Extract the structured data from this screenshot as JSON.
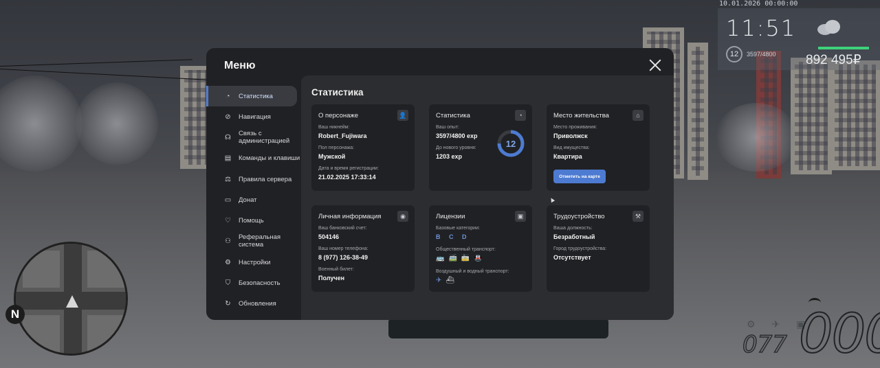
{
  "hud": {
    "datetime": "10.01.2026 00:00:00",
    "time": "11:51",
    "level": "12",
    "exp": "3597/4800",
    "money": "892 495₽",
    "speed": "000",
    "fuel": "077",
    "compass": "N"
  },
  "menu": {
    "title": "Меню",
    "sidebar": [
      {
        "label": "Статистика",
        "icon": "chart-icon",
        "glyph": "◔",
        "active": true
      },
      {
        "label": "Навигация",
        "icon": "compass-icon",
        "glyph": "⊘"
      },
      {
        "label": "Связь с администрацией",
        "icon": "headset-icon",
        "glyph": "☊"
      },
      {
        "label": "Команды и клавиши",
        "icon": "keyboard-icon",
        "glyph": "▤"
      },
      {
        "label": "Правила сервера",
        "icon": "scales-icon",
        "glyph": "⚖"
      },
      {
        "label": "Донат",
        "icon": "wallet-icon",
        "glyph": "▭"
      },
      {
        "label": "Помощь",
        "icon": "heart-hand-icon",
        "glyph": "♡"
      },
      {
        "label": "Реферальная система",
        "icon": "network-icon",
        "glyph": "⚇"
      },
      {
        "label": "Настройки",
        "icon": "gear-icon",
        "glyph": "⚙"
      },
      {
        "label": "Безопасность",
        "icon": "shield-icon",
        "glyph": "⛉"
      },
      {
        "label": "Обновления",
        "icon": "refresh-icon",
        "glyph": "↻"
      }
    ]
  },
  "content": {
    "title": "Статистика",
    "character": {
      "title": "О персонаже",
      "nick_label": "Ваш никнейм:",
      "nick": "Robert_Fujiwara",
      "gender_label": "Пол персонажа:",
      "gender": "Мужской",
      "reg_label": "Дата и время регистрации:",
      "reg": "21.02.2025 17:33:14"
    },
    "stats": {
      "title": "Статистика",
      "exp_label": "Ваш опыт:",
      "exp": "3597/4800 exp",
      "next_label": "До нового уровня:",
      "next": "1203 exp",
      "level": "12",
      "progress": 0.749
    },
    "residence": {
      "title": "Место жительства",
      "place_label": "Место проживания:",
      "place": "Приволжск",
      "type_label": "Вид имущества:",
      "type": "Квартира",
      "button": "Отметить на карте"
    },
    "personal": {
      "title": "Личная информация",
      "bank_label": "Ваш банковский счет:",
      "bank": "504146",
      "phone_label": "Ваш номер телефона:",
      "phone": "8 (977) 126-38-49",
      "military_label": "Военный билет:",
      "military": "Получен"
    },
    "licenses": {
      "title": "Лицензии",
      "base_label": "Базовые категории:",
      "base": "B C D",
      "public_label": "Общественный транспорт:",
      "air_label": "Воздушный и водный транспорт:"
    },
    "job": {
      "title": "Трудоустройство",
      "position_label": "Ваша должность:",
      "position": "Безработный",
      "city_label": "Город трудоустройства:",
      "city": "Отсутствует"
    }
  },
  "colors": {
    "accent": "#4d7bd1",
    "panel": "#202124",
    "content": "#2c2d30"
  }
}
